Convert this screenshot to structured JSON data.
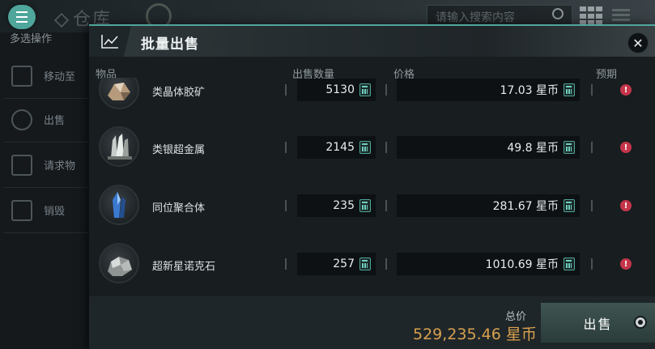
{
  "background": {
    "title": "仓库",
    "search_placeholder": "请输入搜索内容",
    "sidebar_title": "多选操作",
    "sidebar_items": [
      {
        "label": "移动至",
        "icon": "move-to-icon"
      },
      {
        "label": "出售",
        "icon": "sell-icon"
      },
      {
        "label": "请求物",
        "icon": "request-chart-icon"
      },
      {
        "label": "销毁",
        "icon": "destroy-box-icon"
      }
    ]
  },
  "modal": {
    "title": "批量出售",
    "headers": {
      "item": "物品",
      "quantity": "出售数量",
      "price": "价格",
      "expected": "预期"
    },
    "rows": [
      {
        "name": "类晶体胶矿",
        "quantity": "5130",
        "price": "17.03 星币",
        "icon": "crystal-ore-icon"
      },
      {
        "name": "类银超金属",
        "quantity": "2145",
        "price": "49.8 星币",
        "icon": "silver-metal-icon"
      },
      {
        "name": "同位聚合体",
        "quantity": "235",
        "price": "281.67 星币",
        "icon": "blue-crystal-icon"
      },
      {
        "name": "超新星诺克石",
        "quantity": "257",
        "price": "1010.69 星币",
        "icon": "nocxium-rock-icon"
      }
    ],
    "total_label": "总价",
    "total_value": "529,235.46 星币",
    "sell_button": "出售"
  },
  "colors": {
    "accent": "#4fa69b",
    "total": "#d8a04f",
    "warning": "#c4354a"
  }
}
